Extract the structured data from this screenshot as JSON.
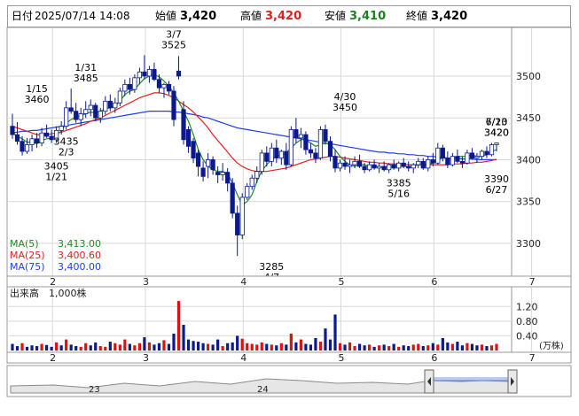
{
  "header": {
    "date_label": "日付",
    "datetime": "2025/07/14 14:08",
    "open_label": "始値",
    "open_value": "3,420",
    "high_label": "高値",
    "high_value": "3,420",
    "low_label": "安値",
    "low_value": "3,410",
    "close_label": "終値",
    "close_value": "3,420"
  },
  "colors": {
    "candle": "#0a1a8c",
    "vol_down": "#0a1a8c",
    "vol_up": "#e01010",
    "ma5": "#208a20",
    "ma25": "#e02020",
    "ma75": "#2040e0",
    "grid": "#d8d8d8",
    "frame": "#9a9a9a"
  },
  "chart_data": [
    {
      "type": "candlestick",
      "name": "price",
      "ylim": [
        3265,
        3555
      ],
      "y_ticks": [
        3300,
        3350,
        3400,
        3450,
        3500
      ],
      "x_month_labels": [
        "2",
        "3",
        "4",
        "5",
        "6",
        "7"
      ],
      "month_start_index": [
        10,
        29,
        49,
        69,
        88,
        108
      ],
      "grid": true,
      "candles": [
        [
          3440,
          3455,
          3425,
          3430
        ],
        [
          3430,
          3445,
          3418,
          3422
        ],
        [
          3422,
          3428,
          3405,
          3410
        ],
        [
          3410,
          3426,
          3407,
          3418
        ],
        [
          3418,
          3430,
          3410,
          3425
        ],
        [
          3425,
          3432,
          3414,
          3420
        ],
        [
          3420,
          3438,
          3416,
          3432
        ],
        [
          3432,
          3442,
          3426,
          3428
        ],
        [
          3428,
          3436,
          3420,
          3424
        ],
        [
          3424,
          3440,
          3420,
          3435
        ],
        [
          3435,
          3446,
          3430,
          3440
        ],
        [
          3440,
          3470,
          3436,
          3462
        ],
        [
          3462,
          3485,
          3455,
          3458
        ],
        [
          3458,
          3468,
          3444,
          3448
        ],
        [
          3448,
          3462,
          3440,
          3455
        ],
        [
          3455,
          3470,
          3450,
          3460
        ],
        [
          3460,
          3472,
          3452,
          3465
        ],
        [
          3465,
          3468,
          3446,
          3450
        ],
        [
          3450,
          3462,
          3444,
          3458
        ],
        [
          3458,
          3476,
          3454,
          3470
        ],
        [
          3470,
          3478,
          3458,
          3462
        ],
        [
          3462,
          3474,
          3456,
          3468
        ],
        [
          3468,
          3486,
          3464,
          3482
        ],
        [
          3482,
          3496,
          3476,
          3490
        ],
        [
          3490,
          3498,
          3478,
          3484
        ],
        [
          3484,
          3502,
          3480,
          3498
        ],
        [
          3498,
          3510,
          3490,
          3505
        ],
        [
          3505,
          3525,
          3496,
          3500
        ],
        [
          3500,
          3512,
          3492,
          3508
        ],
        [
          3508,
          3516,
          3494,
          3496
        ],
        [
          3496,
          3502,
          3480,
          3486
        ],
        [
          3486,
          3492,
          3474,
          3490
        ],
        [
          3490,
          3494,
          3478,
          3482
        ],
        [
          3482,
          3488,
          3440,
          3448
        ],
        [
          3506,
          3524,
          3496,
          3500
        ],
        [
          3460,
          3470,
          3418,
          3424
        ],
        [
          3436,
          3440,
          3408,
          3416
        ],
        [
          3422,
          3426,
          3396,
          3402
        ],
        [
          3408,
          3412,
          3380,
          3392
        ],
        [
          3390,
          3398,
          3374,
          3380
        ],
        [
          3392,
          3408,
          3378,
          3400
        ],
        [
          3400,
          3404,
          3382,
          3388
        ],
        [
          3385,
          3392,
          3372,
          3382
        ],
        [
          3382,
          3396,
          3375,
          3385
        ],
        [
          3385,
          3390,
          3362,
          3372
        ],
        [
          3372,
          3378,
          3330,
          3336
        ],
        [
          3336,
          3345,
          3285,
          3310
        ],
        [
          3310,
          3360,
          3305,
          3355
        ],
        [
          3355,
          3372,
          3352,
          3368
        ],
        [
          3368,
          3382,
          3364,
          3378
        ],
        [
          3378,
          3392,
          3372,
          3386
        ],
        [
          3386,
          3412,
          3382,
          3408
        ],
        [
          3408,
          3416,
          3392,
          3398
        ],
        [
          3398,
          3420,
          3392,
          3414
        ],
        [
          3414,
          3424,
          3396,
          3402
        ],
        [
          3402,
          3412,
          3394,
          3410
        ],
        [
          3410,
          3420,
          3388,
          3394
        ],
        [
          3394,
          3440,
          3392,
          3436
        ],
        [
          3436,
          3450,
          3420,
          3426
        ],
        [
          3426,
          3438,
          3414,
          3430
        ],
        [
          3430,
          3434,
          3406,
          3412
        ],
        [
          3412,
          3420,
          3402,
          3408
        ],
        [
          3408,
          3414,
          3396,
          3402
        ],
        [
          3402,
          3440,
          3400,
          3436
        ],
        [
          3436,
          3442,
          3418,
          3422
        ],
        [
          3422,
          3428,
          3398,
          3404
        ],
        [
          3404,
          3412,
          3385,
          3390
        ],
        [
          3390,
          3400,
          3386,
          3396
        ],
        [
          3396,
          3404,
          3388,
          3392
        ],
        [
          3392,
          3400,
          3384,
          3394
        ],
        [
          3394,
          3404,
          3390,
          3398
        ],
        [
          3398,
          3406,
          3390,
          3392
        ],
        [
          3392,
          3396,
          3384,
          3388
        ],
        [
          3388,
          3398,
          3386,
          3394
        ],
        [
          3394,
          3400,
          3388,
          3390
        ],
        [
          3390,
          3396,
          3384,
          3392
        ],
        [
          3392,
          3398,
          3386,
          3388
        ],
        [
          3388,
          3396,
          3384,
          3394
        ],
        [
          3394,
          3400,
          3388,
          3390
        ],
        [
          3390,
          3398,
          3386,
          3396
        ],
        [
          3396,
          3402,
          3390,
          3392
        ],
        [
          3392,
          3398,
          3386,
          3390
        ],
        [
          3390,
          3396,
          3384,
          3394
        ],
        [
          3394,
          3402,
          3390,
          3398
        ],
        [
          3398,
          3402,
          3388,
          3390
        ],
        [
          3390,
          3404,
          3386,
          3400
        ],
        [
          3400,
          3408,
          3392,
          3396
        ],
        [
          3396,
          3420,
          3394,
          3414
        ],
        [
          3414,
          3418,
          3398,
          3402
        ],
        [
          3402,
          3410,
          3390,
          3394
        ],
        [
          3394,
          3408,
          3392,
          3404
        ],
        [
          3404,
          3412,
          3396,
          3398
        ],
        [
          3398,
          3404,
          3390,
          3396
        ],
        [
          3396,
          3412,
          3394,
          3408
        ],
        [
          3408,
          3414,
          3400,
          3402
        ],
        [
          3402,
          3408,
          3396,
          3404
        ],
        [
          3404,
          3412,
          3400,
          3410
        ],
        [
          3410,
          3416,
          3402,
          3406
        ],
        [
          3406,
          3420,
          3404,
          3418
        ],
        [
          3418,
          3420,
          3410,
          3420
        ]
      ],
      "ma5": [
        3432,
        3428,
        3425,
        3421,
        3421,
        3419,
        3423,
        3425,
        3426,
        3430,
        3434,
        3444,
        3448,
        3451,
        3453,
        3455,
        3457,
        3456,
        3458,
        3461,
        3462,
        3464,
        3470,
        3478,
        3482,
        3484,
        3491,
        3497,
        3500,
        3502,
        3499,
        3494,
        3488,
        3480,
        3470,
        3458,
        3446,
        3430,
        3412,
        3400,
        3392,
        3388,
        3386,
        3386,
        3383,
        3372,
        3358,
        3346,
        3350,
        3358,
        3374,
        3387,
        3394,
        3400,
        3404,
        3406,
        3408,
        3414,
        3420,
        3424,
        3424,
        3420,
        3416,
        3418,
        3420,
        3418,
        3412,
        3404,
        3398,
        3394,
        3392,
        3394,
        3394,
        3392,
        3392,
        3392,
        3391,
        3392,
        3392,
        3392,
        3392,
        3392,
        3392,
        3394,
        3394,
        3394,
        3396,
        3400,
        3402,
        3402,
        3402,
        3404,
        3404,
        3404,
        3406,
        3404,
        3404,
        3406,
        3410,
        3412
      ],
      "ma25": [
        3440,
        3438,
        3436,
        3434,
        3432,
        3430,
        3430,
        3430,
        3431,
        3432,
        3433,
        3435,
        3437,
        3439,
        3441,
        3443,
        3446,
        3448,
        3450,
        3453,
        3456,
        3459,
        3462,
        3465,
        3468,
        3471,
        3474,
        3476,
        3478,
        3480,
        3480,
        3479,
        3477,
        3474,
        3470,
        3466,
        3462,
        3457,
        3451,
        3445,
        3438,
        3430,
        3423,
        3416,
        3409,
        3402,
        3396,
        3392,
        3389,
        3387,
        3386,
        3386,
        3386,
        3387,
        3388,
        3389,
        3390,
        3392,
        3394,
        3396,
        3398,
        3400,
        3401,
        3402,
        3403,
        3404,
        3404,
        3403,
        3402,
        3401,
        3400,
        3399,
        3398,
        3397,
        3397,
        3396,
        3396,
        3395,
        3395,
        3395,
        3395,
        3394,
        3394,
        3394,
        3394,
        3394,
        3394,
        3394,
        3394,
        3394,
        3395,
        3395,
        3395,
        3396,
        3396,
        3397,
        3397,
        3398,
        3399,
        3400.6
      ],
      "ma75": [
        3432,
        3433,
        3434,
        3434,
        3435,
        3435,
        3436,
        3437,
        3438,
        3439,
        3440,
        3441,
        3442,
        3443,
        3444,
        3445,
        3446,
        3447,
        3448,
        3449,
        3450,
        3451,
        3452,
        3453,
        3454,
        3455,
        3456,
        3457,
        3458,
        3458,
        3458,
        3458,
        3458,
        3457,
        3457,
        3456,
        3455,
        3454,
        3453,
        3451,
        3450,
        3448,
        3446,
        3444,
        3442,
        3440,
        3438,
        3437,
        3436,
        3435,
        3434,
        3433,
        3432,
        3431,
        3430,
        3429,
        3428,
        3427,
        3426,
        3425,
        3424,
        3423,
        3422,
        3421,
        3420,
        3419,
        3418,
        3417,
        3416,
        3415,
        3414,
        3413,
        3412,
        3411,
        3410,
        3409,
        3409,
        3408,
        3408,
        3407,
        3407,
        3406,
        3406,
        3405,
        3405,
        3404,
        3404,
        3403,
        3403,
        3402,
        3402,
        3402,
        3401,
        3401,
        3401,
        3400,
        3400,
        3400,
        3400,
        3400
      ],
      "annotations": [
        {
          "date": "1/15",
          "price": "3460",
          "pos": "above"
        },
        {
          "date": "1/31",
          "price": "3485",
          "pos": "above"
        },
        {
          "date": "3/7",
          "price": "3525",
          "pos": "above"
        },
        {
          "date": "4/30",
          "price": "3450",
          "pos": "above"
        },
        {
          "date": "6/23",
          "price": "3420",
          "pos": "above"
        },
        {
          "date": "7/10",
          "price": "3420",
          "pos": "above"
        },
        {
          "date": "1/21",
          "price": "3405",
          "pos": "below"
        },
        {
          "date": "2/3",
          "price": "3435",
          "pos": "below"
        },
        {
          "date": "4/7",
          "price": "3285",
          "pos": "below"
        },
        {
          "date": "5/16",
          "price": "3385",
          "pos": "below"
        },
        {
          "date": "6/27",
          "price": "3390",
          "pos": "below"
        }
      ],
      "legend": [
        {
          "label": "MA(5)",
          "value": "3,413.00"
        },
        {
          "label": "MA(25)",
          "value": "3,400.60"
        },
        {
          "label": "MA(75)",
          "value": "3,400.00"
        }
      ]
    },
    {
      "type": "bar",
      "name": "volume",
      "title": "出来高　1,000株",
      "unit": "(万株)",
      "ylim": [
        0,
        1.4
      ],
      "y_ticks": [
        "1.20",
        "0.80",
        "0.40"
      ],
      "values": [
        0.18,
        0.12,
        0.2,
        0.1,
        0.14,
        0.12,
        0.18,
        0.15,
        0.1,
        0.22,
        0.14,
        0.3,
        0.16,
        0.12,
        0.1,
        0.2,
        0.14,
        0.22,
        0.12,
        0.1,
        0.24,
        0.2,
        0.16,
        0.3,
        0.18,
        0.14,
        0.2,
        0.36,
        0.22,
        0.16,
        0.2,
        0.28,
        0.18,
        0.46,
        1.35,
        0.7,
        0.3,
        0.26,
        0.24,
        0.2,
        0.18,
        0.16,
        0.3,
        0.12,
        0.2,
        0.22,
        0.4,
        0.32,
        0.2,
        0.18,
        0.16,
        0.22,
        0.18,
        0.16,
        0.14,
        0.2,
        0.16,
        0.46,
        0.22,
        0.3,
        0.18,
        0.16,
        0.34,
        0.24,
        0.6,
        0.3,
        0.98,
        0.2,
        0.16,
        0.22,
        0.12,
        0.18,
        0.14,
        0.16,
        0.1,
        0.14,
        0.16,
        0.12,
        0.18,
        0.1,
        0.14,
        0.12,
        0.16,
        0.18,
        0.12,
        0.14,
        0.2,
        0.16,
        0.34,
        0.22,
        0.18,
        0.24,
        0.14,
        0.2,
        0.18,
        0.14,
        0.16,
        0.12,
        0.14,
        0.18
      ],
      "up": [
        0,
        0,
        1,
        0,
        0,
        0,
        1,
        0,
        0,
        1,
        0,
        1,
        0,
        0,
        1,
        1,
        0,
        0,
        1,
        1,
        0,
        1,
        1,
        1,
        0,
        1,
        1,
        0,
        1,
        0,
        0,
        1,
        0,
        0,
        1,
        0,
        0,
        0,
        0,
        0,
        1,
        0,
        0,
        1,
        0,
        0,
        0,
        1,
        1,
        1,
        1,
        1,
        0,
        1,
        0,
        1,
        0,
        1,
        0,
        1,
        0,
        0,
        0,
        1,
        0,
        0,
        0,
        1,
        0,
        1,
        1,
        0,
        0,
        1,
        0,
        1,
        0,
        1,
        0,
        1,
        0,
        0,
        1,
        1,
        0,
        1,
        0,
        1,
        0,
        0,
        1,
        0,
        0,
        1,
        0,
        0,
        1,
        0,
        1,
        1
      ]
    }
  ],
  "navigator": {
    "labels": [
      "23",
      "24"
    ]
  }
}
